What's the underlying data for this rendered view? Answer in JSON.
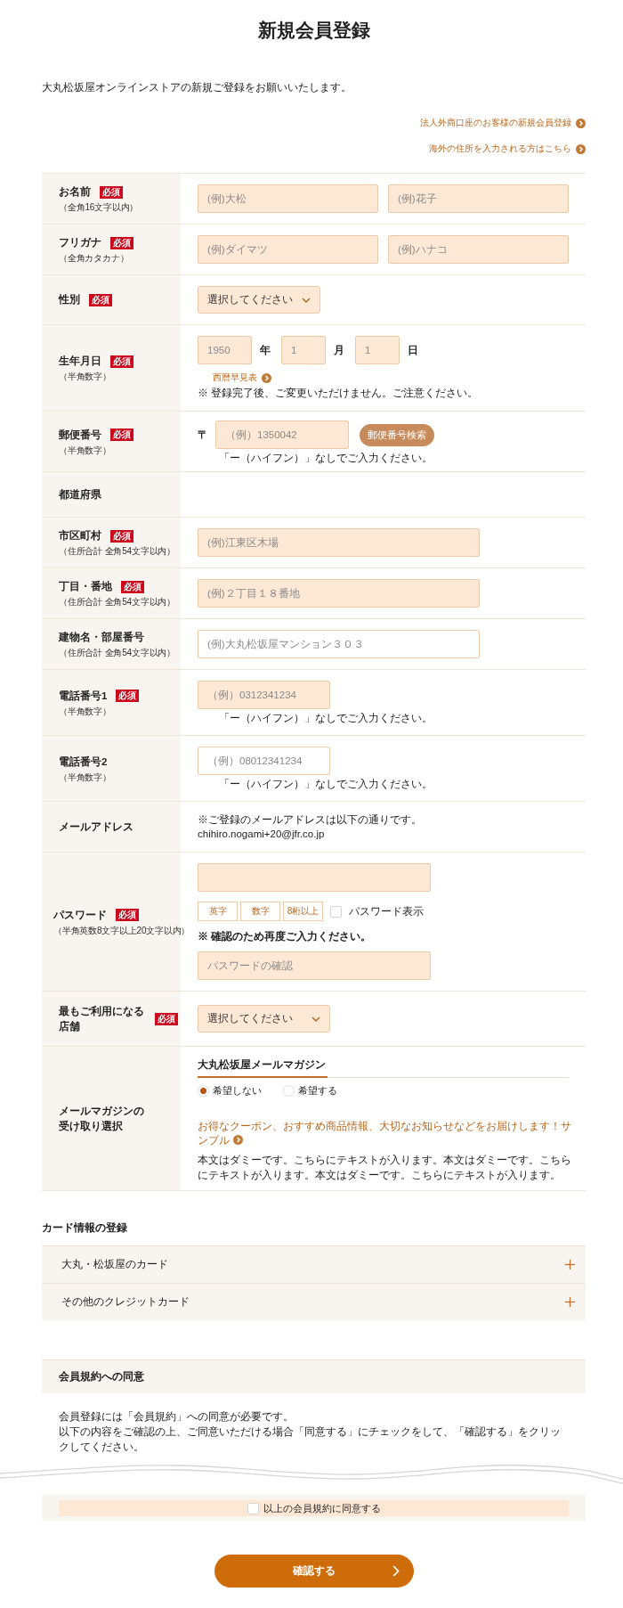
{
  "title": "新規会員登録",
  "intro": "大丸松坂屋オンラインストアの新規ご登録をお願いいたします。",
  "links": [
    "法人外商口座のお客様の新規会員登録",
    "海外の住所を入力される方はこちら"
  ],
  "form": [
    {
      "kind": "pair",
      "label": "お名前",
      "badge": "必須",
      "note": "（全角16文字以内）",
      "fields": [
        {
          "placeholder": "(例)大松"
        },
        {
          "placeholder": "(例)花子"
        }
      ]
    },
    {
      "kind": "pair",
      "label": "フリガナ",
      "badge": "必須",
      "note": "（全角カタカナ）",
      "fields": [
        {
          "placeholder": "(例)ダイマツ"
        },
        {
          "placeholder": "(例)ハナコ"
        }
      ]
    },
    {
      "kind": "select",
      "label": "性別",
      "badge": "必須",
      "value": "選択してください"
    },
    {
      "kind": "date",
      "label": "生年月日",
      "badge": "必須",
      "note": "（半角数字）",
      "parts": [
        {
          "placeholder": "1950",
          "unit": "年"
        },
        {
          "placeholder": "1",
          "unit": "月"
        },
        {
          "placeholder": "1",
          "unit": "日"
        }
      ],
      "link": "西暦早見表",
      "remark": "※ 登録完了後、ご変更いただけません。ご注意ください。"
    },
    {
      "kind": "postal",
      "label": "郵便番号",
      "badge": "必須",
      "note": "（半角数字）",
      "prefix": "〒",
      "placeholder": "（例）1350042",
      "button": "郵便番号検索",
      "hint": "「ー（ハイフン）」なしでご入力ください。"
    },
    {
      "kind": "blank",
      "label": "都道府県"
    },
    {
      "kind": "text",
      "label": "市区町村",
      "badge": "必須",
      "note": "（住所合計 全角54文字以内）",
      "placeholder": "(例)江東区木場"
    },
    {
      "kind": "text",
      "label": "丁目・番地",
      "badge": "必須",
      "note": "（住所合計 全角54文字以内）",
      "placeholder": "(例)２丁目１８番地"
    },
    {
      "kind": "text",
      "label": "建物名・部屋番号",
      "note": "（住所合計 全角54文字以内）",
      "placeholder": "(例)大丸松坂屋マンション３０３"
    },
    {
      "kind": "phone",
      "label": "電話番号1",
      "badge": "必須",
      "note": "（半角数字）",
      "placeholder": "（例）0312341234",
      "hint": "「ー（ハイフン）」なしでご入力ください。"
    },
    {
      "kind": "phone",
      "label": "電話番号2",
      "note": "（半角数字）",
      "placeholder": "（例）08012341234",
      "hint": "「ー（ハイフン）」なしでご入力ください。"
    },
    {
      "kind": "email",
      "label": "メールアドレス",
      "lines": [
        "※ご登録のメールアドレスは以下の通りです。",
        "chihiro.nogami+20@jfr.co.jp"
      ]
    },
    {
      "kind": "password",
      "label": "パスワード",
      "badge": "必須",
      "note": "（半角英数8文字以上20文字以内）",
      "rules": [
        "英字",
        "数字",
        "8桁以上"
      ],
      "show": {
        "label": "パスワード表示",
        "checked": false
      },
      "remark": "※ 確認のため再度ご入力ください。",
      "confirm_placeholder": "パスワードの確認"
    },
    {
      "kind": "dropdown",
      "label": "最もご利用になる店舗",
      "badge": "必須",
      "value": "選択してください"
    },
    {
      "kind": "radio",
      "label": "メールマガジンの受け取り選択",
      "heading": "大丸松坂屋メールマガジン",
      "options": [
        {
          "label": "希望しない",
          "selected": true
        },
        {
          "label": "希望する",
          "selected": false
        }
      ],
      "link": "お得なクーポン、おすすめ商品情報、大切なお知らせなどをお届けします！サンプル",
      "body": "本文はダミーです。こちらにテキストが入ります。本文はダミーです。こちらにテキストが入ります。本文はダミーです。こちらにテキストが入ります。"
    }
  ],
  "cards": {
    "title": "カード情報の登録",
    "items": [
      {
        "label": "大丸・松坂屋のカード",
        "expanded": false
      },
      {
        "label": "その他のクレジットカード",
        "expanded": false
      }
    ]
  },
  "terms": {
    "title": "会員規約への同意",
    "lines": [
      "会員登録には「会員規約」への同意が必要です。",
      "以下の内容をご確認の上、ご同意いただける場合「同意する」にチェックをして、「確認する」をクリックしてください。"
    ],
    "agree": {
      "label": "以上の会員規約に同意する",
      "checked": false
    }
  },
  "submit": "確認する"
}
